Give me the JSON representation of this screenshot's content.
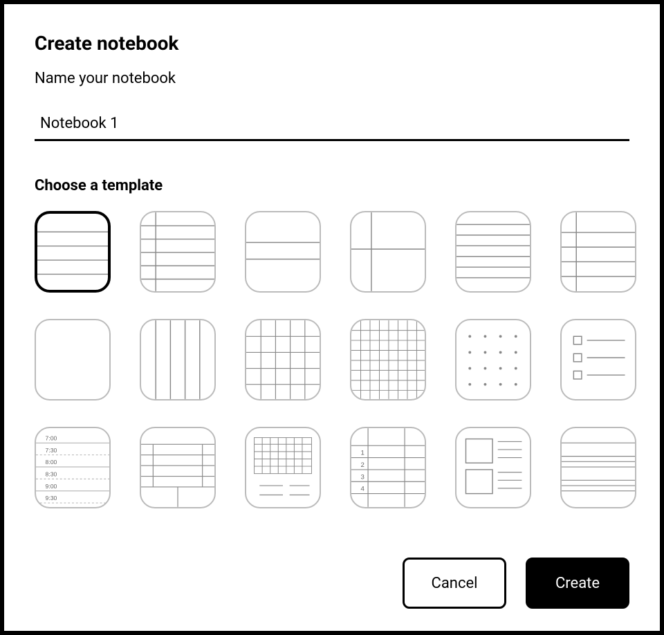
{
  "dialog": {
    "title": "Create notebook",
    "name_label": "Name your notebook",
    "name_value": "Notebook 1",
    "template_label": "Choose a template"
  },
  "schedule_times": [
    "7:00",
    "7:30",
    "8:00",
    "8:30",
    "9:00",
    "9:30"
  ],
  "numbered_rows": [
    "1",
    "2",
    "3",
    "4"
  ],
  "actions": {
    "cancel": "Cancel",
    "create": "Create"
  },
  "templates": [
    {
      "id": "lined-wide",
      "selected": true
    },
    {
      "id": "lined-margin-left"
    },
    {
      "id": "split-header"
    },
    {
      "id": "split-vertical"
    },
    {
      "id": "lined-dense"
    },
    {
      "id": "lined-margin-top"
    },
    {
      "id": "blank"
    },
    {
      "id": "columns"
    },
    {
      "id": "grid-large"
    },
    {
      "id": "grid-small"
    },
    {
      "id": "dot-grid"
    },
    {
      "id": "checklist"
    },
    {
      "id": "schedule"
    },
    {
      "id": "table-split"
    },
    {
      "id": "calendar-month"
    },
    {
      "id": "numbered-list"
    },
    {
      "id": "cornell-notes"
    },
    {
      "id": "lined-group"
    }
  ]
}
